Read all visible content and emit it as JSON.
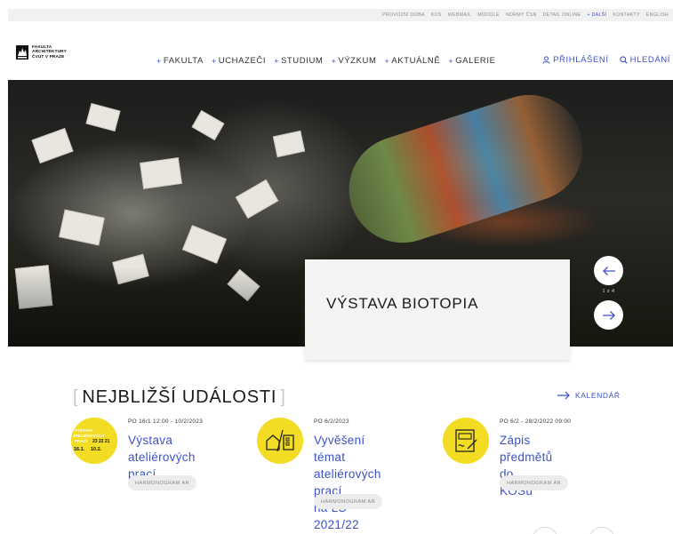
{
  "utility_nav": {
    "items": [
      "PROVOZNÍ DOBA",
      "KOS",
      "WEBMAIL",
      "MOODLE",
      "NORMY ČSN",
      "DETAIL ONLINE"
    ],
    "more": "+ DALŠÍ",
    "trailing": [
      "KONTAKTY",
      "ENGLISH"
    ]
  },
  "logo": {
    "line1": "FAKULTA",
    "line2": "ARCHITEKTURY",
    "line3": "ČVUT V PRAZE"
  },
  "main_nav": {
    "items": [
      "FAKULTA",
      "UCHAZEČI",
      "STUDIUM",
      "VÝZKUM",
      "AKTUÁLNĚ",
      "GALERIE"
    ],
    "plus": "+"
  },
  "user_nav": {
    "login": "PŘIHLÁŠENÍ",
    "search": "HLEDÁNÍ"
  },
  "hero": {
    "caption": "VÝSTAVA BIOTOPIA",
    "counter": "1 z 4"
  },
  "events": {
    "heading": "NEJBLIŽŠÍ UDÁLOSTI",
    "bracket_open": "[",
    "bracket_close": "]",
    "calendar_link": "KALENDÁŘ",
    "items": [
      {
        "date": "PO 16/1 12:00 - 10/2/2023",
        "title_lines": [
          "Výstava ateliérových",
          "prací"
        ],
        "tag": "HARMONOGRAM AR",
        "icon": "exhibition-poster"
      },
      {
        "date": "PO 6/2/2023",
        "title_lines": [
          "Vyvěšení témat",
          "ateliérových prací",
          "na LS 2021/22"
        ],
        "tag": "HARMONOGRAM AR",
        "icon": "house-building-icon"
      },
      {
        "date": "PO 6/2 - 28/2/2022 09:00",
        "title_lines": [
          "Zápis předmětů do",
          "KOSu"
        ],
        "tag": "HARMONOGRAM AR",
        "icon": "form-sign-icon"
      }
    ],
    "poster_text": {
      "l1": "VÝSTAVA",
      "l2": "ATELIÉROVÝCH",
      "l3": "PRACÍ",
      "d1": "23 22 21",
      "d2": "16.1.",
      "d3": "10.2."
    }
  },
  "colors": {
    "accent": "#3d52c4",
    "event_bubble": "#f3dd24",
    "util_bar": "#f1f1f1"
  }
}
